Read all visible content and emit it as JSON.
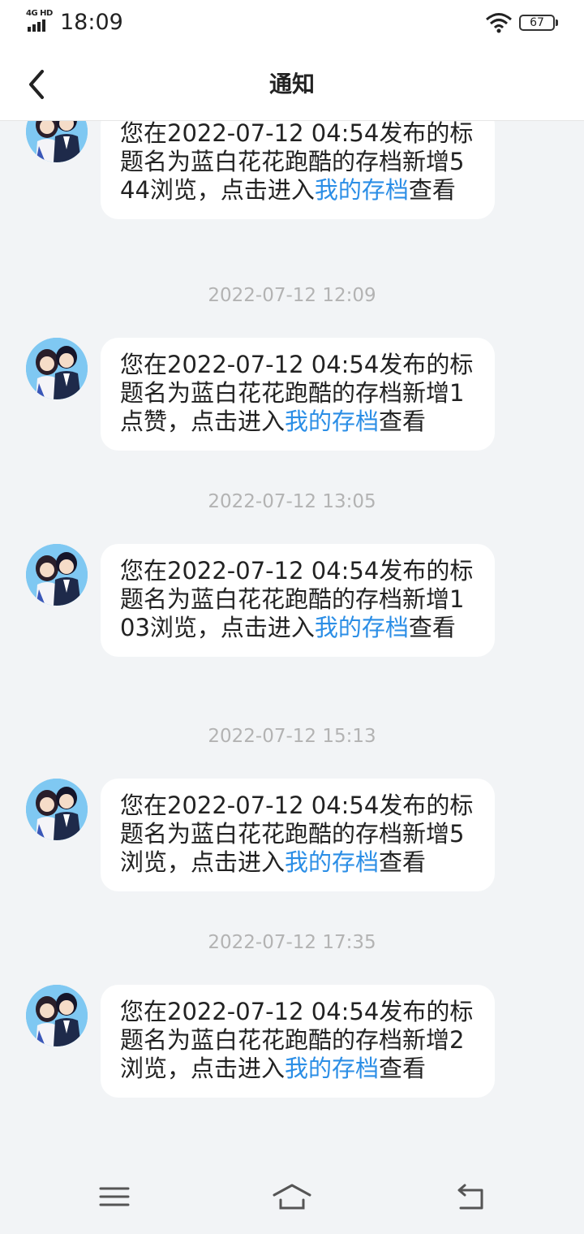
{
  "status_bar": {
    "network": "4G HD",
    "time": "18:09",
    "battery": "67"
  },
  "header": {
    "title": "通知",
    "back_icon": "chevron-left-icon"
  },
  "messages": [
    {
      "time": "",
      "text_before": "您在2022-07-12 04:54发布的标题名为蓝白花花跑酷的存档新增544浏览，点击进入",
      "link": "我的存档",
      "text_after": "查看"
    },
    {
      "time": "2022-07-12 12:09",
      "text_before": "您在2022-07-12 04:54发布的标题名为蓝白花花跑酷的存档新增1点赞，点击进入",
      "link": "我的存档",
      "text_after": "查看"
    },
    {
      "time": "2022-07-12 13:05",
      "text_before": "您在2022-07-12 04:54发布的标题名为蓝白花花跑酷的存档新增103浏览，点击进入",
      "link": "我的存档",
      "text_after": "查看"
    },
    {
      "time": "2022-07-12 15:13",
      "text_before": "您在2022-07-12 04:54发布的标题名为蓝白花花跑酷的存档新增5浏览，点击进入",
      "link": "我的存档",
      "text_after": "查看"
    },
    {
      "time": "2022-07-12 17:35",
      "text_before": "您在2022-07-12 04:54发布的标题名为蓝白花花跑酷的存档新增2浏览，点击进入",
      "link": "我的存档",
      "text_after": "查看"
    }
  ],
  "nav_bar": {
    "icons": [
      "menu-icon",
      "home-icon",
      "back-icon"
    ]
  },
  "colors": {
    "link": "#2b8ee6",
    "background": "#f2f4f6",
    "timestamp": "#b3b3b3"
  }
}
